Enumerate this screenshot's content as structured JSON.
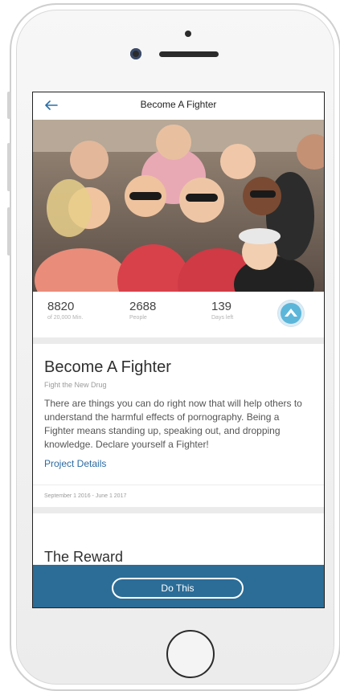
{
  "navbar": {
    "title": "Become A Fighter"
  },
  "stats": [
    {
      "value": "8820",
      "label": "of 20,000 Min."
    },
    {
      "value": "2688",
      "label": "People"
    },
    {
      "value": "139",
      "label": "Days left"
    }
  ],
  "card": {
    "title": "Become A Fighter",
    "subtitle": "Fight the New Drug",
    "description": "There are things you can do right now that will help others to understand the harmful effects of pornography. Being a Fighter means standing up, speaking out, and dropping knowledge. Declare yourself a Fighter!",
    "link": "Project Details",
    "dates": "September 1 2016 - June 1 2017"
  },
  "reward": {
    "title": "The Reward"
  },
  "cta": {
    "label": "Do This"
  },
  "colors": {
    "accent": "#2b6d97",
    "link": "#2b6aa2"
  },
  "icons": {
    "back": "arrow-left-icon",
    "badge": "mountain-logo-icon"
  }
}
